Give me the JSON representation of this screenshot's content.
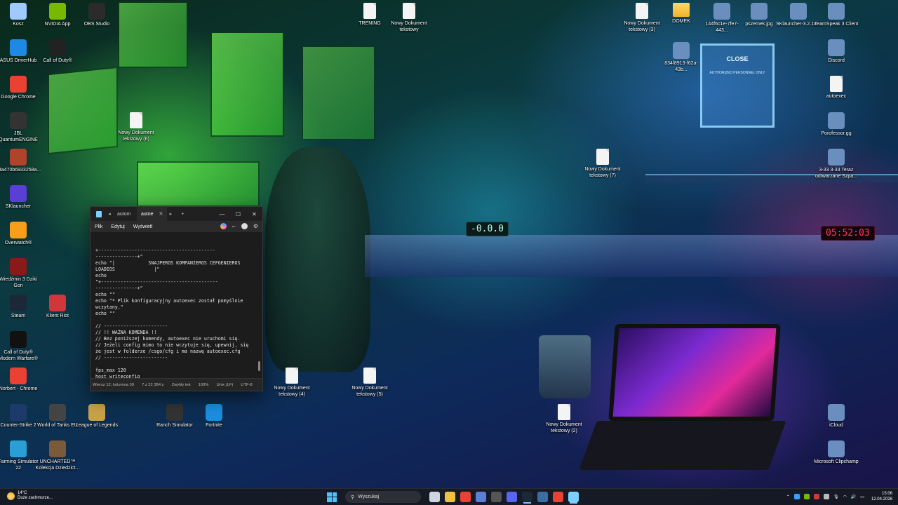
{
  "desktop": {
    "icons_left": [
      {
        "label": "Kosz",
        "icon": "recycle-bin-icon",
        "color": "#9fc9ff"
      },
      {
        "label": "NVIDIA App",
        "icon": "nvidia-icon",
        "color": "#76b900"
      },
      {
        "label": "OBS Studio",
        "icon": "obs-icon",
        "color": "#2b2b2b"
      },
      {
        "label": "ASUS DriverHub",
        "icon": "asus-icon",
        "color": "#1e88e5"
      },
      {
        "label": "Call of Duty®",
        "icon": "cod-icon",
        "color": "#222222"
      },
      {
        "label": "Google Chrome",
        "icon": "chrome-icon",
        "color": "#e94235"
      },
      {
        "label": "JBL QuantumENGINE",
        "icon": "jbl-icon",
        "color": "#333333"
      },
      {
        "label": "43a470b6933258a...",
        "icon": "image-icon",
        "color": "#b0442a"
      },
      {
        "label": "SKlauncher",
        "icon": "sklauncher-icon",
        "color": "#5a3fd6"
      },
      {
        "label": "Overwatch®",
        "icon": "overwatch-icon",
        "color": "#f99e1a"
      },
      {
        "label": "Wiedźmin 3 Dziki Gon",
        "icon": "witcher-icon",
        "color": "#8a1a1a"
      },
      {
        "label": "Steam",
        "icon": "steam-icon",
        "color": "#1b2838"
      },
      {
        "label": "Klient Riot",
        "icon": "riot-icon",
        "color": "#d13639"
      },
      {
        "label": "Call of Duty® Modern Warfare®",
        "icon": "mw-icon",
        "color": "#111111"
      },
      {
        "label": "Norbert - Chrome",
        "icon": "chrome-profile-icon",
        "color": "#e94235"
      },
      {
        "label": "Counter-Strike 2",
        "icon": "cs2-icon",
        "color": "#1e3a6a"
      },
      {
        "label": "World of Tanks EU",
        "icon": "wot-icon",
        "color": "#444444"
      },
      {
        "label": "League of Legends",
        "icon": "lol-icon",
        "color": "#c8a24a"
      },
      {
        "label": "Ranch Simulator",
        "icon": "ranch-icon",
        "color": "#333333"
      },
      {
        "label": "Fortnite",
        "icon": "fortnite-icon",
        "color": "#1c8de0"
      },
      {
        "label": "Farming Simulator 22",
        "icon": "fs22-icon",
        "color": "#2a9fd6"
      },
      {
        "label": "UNCHARTED™ Kolekcja Dziedzict...",
        "icon": "uncharted-icon",
        "color": "#7a5a3a"
      }
    ],
    "icons_right": [
      {
        "label": "TRENING",
        "icon": "document-icon"
      },
      {
        "label": "Nowy Dokument tekstowy",
        "icon": "document-icon"
      },
      {
        "label": "Nowy Dokument tekstowy (3)",
        "icon": "document-icon"
      },
      {
        "label": "DOMEK",
        "icon": "folder-icon"
      },
      {
        "label": "144f6c1e-7fe7-443...",
        "icon": "image-icon"
      },
      {
        "label": "pszemek.jpg",
        "icon": "image-icon"
      },
      {
        "label": "SKlauncher-3.2.18...",
        "icon": "sklauncher-icon"
      },
      {
        "label": "TeamSpeak 3 Client",
        "icon": "teamspeak-icon"
      },
      {
        "label": "834f8913-f62a-43b...",
        "icon": "image-icon"
      },
      {
        "label": "Discord",
        "icon": "discord-icon"
      },
      {
        "label": "autoexec",
        "icon": "document-icon"
      },
      {
        "label": "Nowy Dokument tekstowy (6)",
        "icon": "document-icon"
      },
      {
        "label": "Porofessor.gg",
        "icon": "porofessor-icon"
      },
      {
        "label": "Nowy Dokument tekstowy (7)",
        "icon": "document-icon"
      },
      {
        "label": "3-33 3-33 Teraz odtwarzane Szpa...",
        "icon": "chrome-icon"
      },
      {
        "label": "Nowy Dokument tekstowy (4)",
        "icon": "document-icon"
      },
      {
        "label": "Nowy Dokument tekstowy (5)",
        "icon": "document-icon"
      },
      {
        "label": "Nowy Dokument tekstowy (2)",
        "icon": "document-icon"
      },
      {
        "label": "iCloud",
        "icon": "icloud-icon"
      },
      {
        "label": "Microsoft Clipchamp",
        "icon": "clipchamp-icon"
      }
    ],
    "wallpaper": {
      "clock_left": "-0.0.0",
      "clock_right": "05:52:03",
      "sign_text": "CLOSE",
      "sign_sub": "AUTHORIZED PERSONNEL ONLY"
    }
  },
  "notepad": {
    "tabs": [
      {
        "label": "autom"
      },
      {
        "label": "autoe"
      }
    ],
    "menu": [
      "Plik",
      "Edytuj",
      "Wyświetl"
    ],
    "window_buttons": [
      "—",
      "☐",
      "✕"
    ],
    "lines": [
      "+------------------------------------------",
      "---------------+\"",
      "echo \"|            SNAJPEROS KOMPANIEROS CEFGENIEROS",
      "LOADEOS              |\"",
      "echo",
      "\"+------------------------------------------",
      "---------------+\"",
      "echo \"\"",
      "echo \"* Plik konfiguracyjny autoexec został pomyślnie",
      "wczytany.\"",
      "echo \"\"",
      "",
      "// -----------------------",
      "// !! WAŻNA KOMENDA !!",
      "// Bez poniższej komendy, autoexec nie uruchomi się.",
      "// Jeżeli config mimo to nie wczytuje się, upewnij, się",
      "że jest w folderze /csgo/cfg i ma nazwę autoexec.cfg",
      "// -----------------------",
      "",
      "fps_max 120",
      "host_writeconfig"
    ],
    "status": {
      "position": "Wiersz 12, kolumna 39",
      "chars": "7 z 22 384 z",
      "format": "Zwykły tek",
      "zoom": "100%",
      "line_ending": "Unix (LF)",
      "encoding": "UTF-8"
    }
  },
  "taskbar": {
    "weather_temp": "14°C",
    "weather_desc": "Duże zachmurze...",
    "search_placeholder": "Wyszukaj",
    "apps": [
      {
        "name": "task-view-icon",
        "color": "#cfd6e0"
      },
      {
        "name": "file-explorer-icon",
        "color": "#f0c040"
      },
      {
        "name": "chrome-taskbar-icon",
        "color": "#e94235"
      },
      {
        "name": "app-icon-1",
        "color": "#5a7fd6"
      },
      {
        "name": "obs-taskbar-icon",
        "color": "#555555"
      },
      {
        "name": "discord-taskbar-icon",
        "color": "#5865f2"
      },
      {
        "name": "steam-taskbar-icon",
        "color": "#1b2838"
      },
      {
        "name": "app-icon-2",
        "color": "#3a6ea5"
      },
      {
        "name": "chrome-profile-taskbar-icon",
        "color": "#e94235"
      },
      {
        "name": "notepad-taskbar-icon",
        "color": "#7ad0ff"
      }
    ],
    "time": "15:06",
    "date": "12.04.2026"
  }
}
